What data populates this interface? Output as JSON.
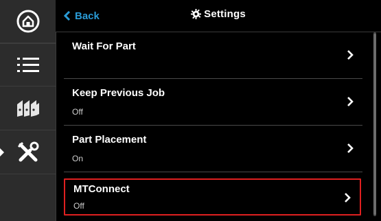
{
  "header": {
    "back_label": "Back",
    "title": "Settings"
  },
  "sidebar": {
    "items": [
      {
        "icon": "home-icon"
      },
      {
        "icon": "list-icon"
      },
      {
        "icon": "parts-icon"
      },
      {
        "icon": "tools-icon",
        "active": true
      }
    ]
  },
  "settings": {
    "items": [
      {
        "label": "Wait For Part",
        "value": ""
      },
      {
        "label": "Keep Previous Job",
        "value": "Off"
      },
      {
        "label": "Part Placement",
        "value": "On"
      },
      {
        "label": "MTConnect",
        "value": "Off",
        "highlighted": true
      }
    ]
  },
  "colors": {
    "accent": "#2a9bd6",
    "highlight": "#e02020",
    "sidebar_bg": "#2c2c2c",
    "background": "#000000"
  }
}
